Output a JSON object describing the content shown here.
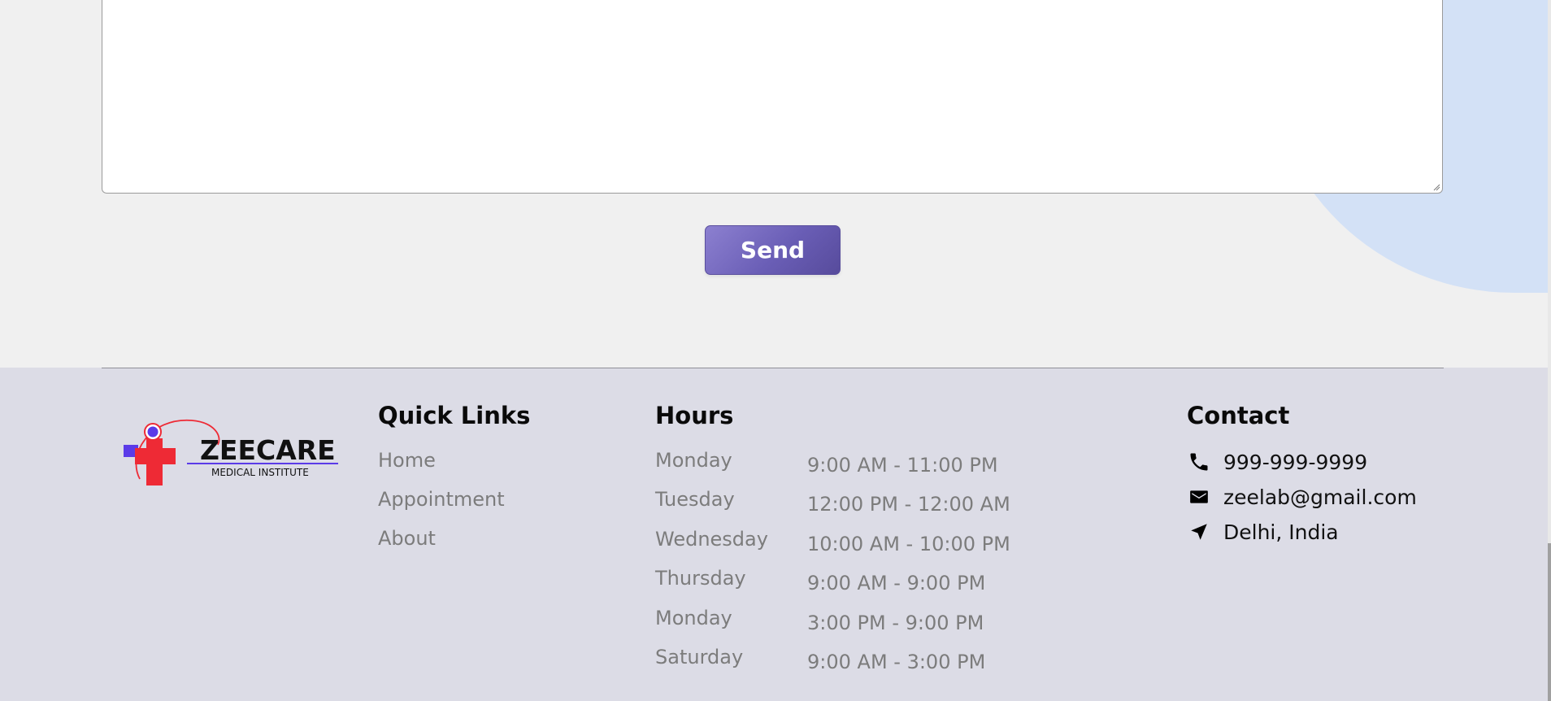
{
  "contact_form": {
    "send_label": "Send"
  },
  "footer": {
    "logo": {
      "brand": "ZEECARE",
      "tagline": "MEDICAL INSTITUTE"
    },
    "quick_links": {
      "title": "Quick Links",
      "items": [
        {
          "label": "Home"
        },
        {
          "label": "Appointment"
        },
        {
          "label": "About"
        }
      ]
    },
    "hours": {
      "title": "Hours",
      "rows": [
        {
          "day": "Monday",
          "time": "9:00 AM - 11:00 PM"
        },
        {
          "day": "Tuesday",
          "time": "12:00 PM - 12:00 AM"
        },
        {
          "day": "Wednesday",
          "time": "10:00 AM - 10:00 PM"
        },
        {
          "day": "Thursday",
          "time": "9:00 AM - 9:00 PM"
        },
        {
          "day": "Monday",
          "time": "3:00 PM - 9:00 PM"
        },
        {
          "day": "Saturday",
          "time": "9:00 AM - 3:00 PM"
        }
      ]
    },
    "contact": {
      "title": "Contact",
      "items": [
        {
          "icon": "phone-icon",
          "text": "999-999-9999"
        },
        {
          "icon": "mail-icon",
          "text": "zeelab@gmail.com"
        },
        {
          "icon": "location-arrow-icon",
          "text": "Delhi, India"
        }
      ]
    }
  },
  "colors": {
    "page_bg": "#f0f0f0",
    "footer_bg": "#dcdce6",
    "button_start": "#8c80d0",
    "button_end": "#574b9c",
    "blob": "#d3e1f6",
    "logo_red": "#ee2a35",
    "logo_purple": "#5b3be8"
  }
}
